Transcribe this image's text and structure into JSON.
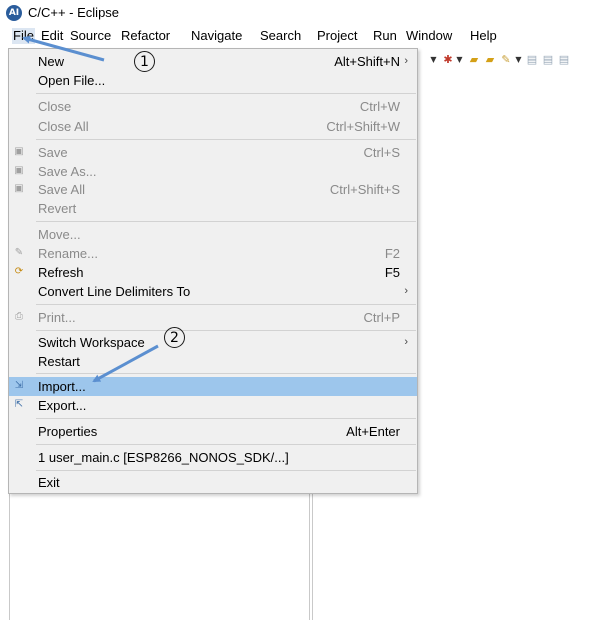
{
  "window": {
    "title": "C/C++ - Eclipse",
    "logo_text": "AI"
  },
  "menubar": {
    "items": [
      "File",
      "Edit",
      "Source",
      "Refactor",
      "Navigate",
      "Search",
      "Project",
      "Run",
      "Window",
      "Help"
    ]
  },
  "file_menu": {
    "new": {
      "label": "New",
      "shortcut": "Alt+Shift+N",
      "submenu": "›"
    },
    "open_file": {
      "label": "Open File..."
    },
    "close": {
      "label": "Close",
      "shortcut": "Ctrl+W"
    },
    "close_all": {
      "label": "Close All",
      "shortcut": "Ctrl+Shift+W"
    },
    "save": {
      "label": "Save",
      "shortcut": "Ctrl+S"
    },
    "save_as": {
      "label": "Save As..."
    },
    "save_all": {
      "label": "Save All",
      "shortcut": "Ctrl+Shift+S"
    },
    "revert": {
      "label": "Revert"
    },
    "move": {
      "label": "Move..."
    },
    "rename": {
      "label": "Rename...",
      "shortcut": "F2"
    },
    "refresh": {
      "label": "Refresh",
      "shortcut": "F5"
    },
    "convert": {
      "label": "Convert Line Delimiters To",
      "submenu": "›"
    },
    "print": {
      "label": "Print...",
      "shortcut": "Ctrl+P"
    },
    "switch_workspace": {
      "label": "Switch Workspace",
      "submenu": "›"
    },
    "restart": {
      "label": "Restart"
    },
    "import": {
      "label": "Import..."
    },
    "export": {
      "label": "Export..."
    },
    "properties": {
      "label": "Properties",
      "shortcut": "Alt+Enter"
    },
    "recent_1": {
      "label": "1 user_main.c  [ESP8266_NONOS_SDK/...]"
    },
    "exit": {
      "label": "Exit"
    }
  },
  "annotations": {
    "step1": "1",
    "step2": "2",
    "arrow_color": "#5b8fd0"
  },
  "colors": {
    "highlight": "#9dc6ec",
    "menu_bg": "#f0f0f0",
    "disabled_text": "#8a8a8a"
  }
}
